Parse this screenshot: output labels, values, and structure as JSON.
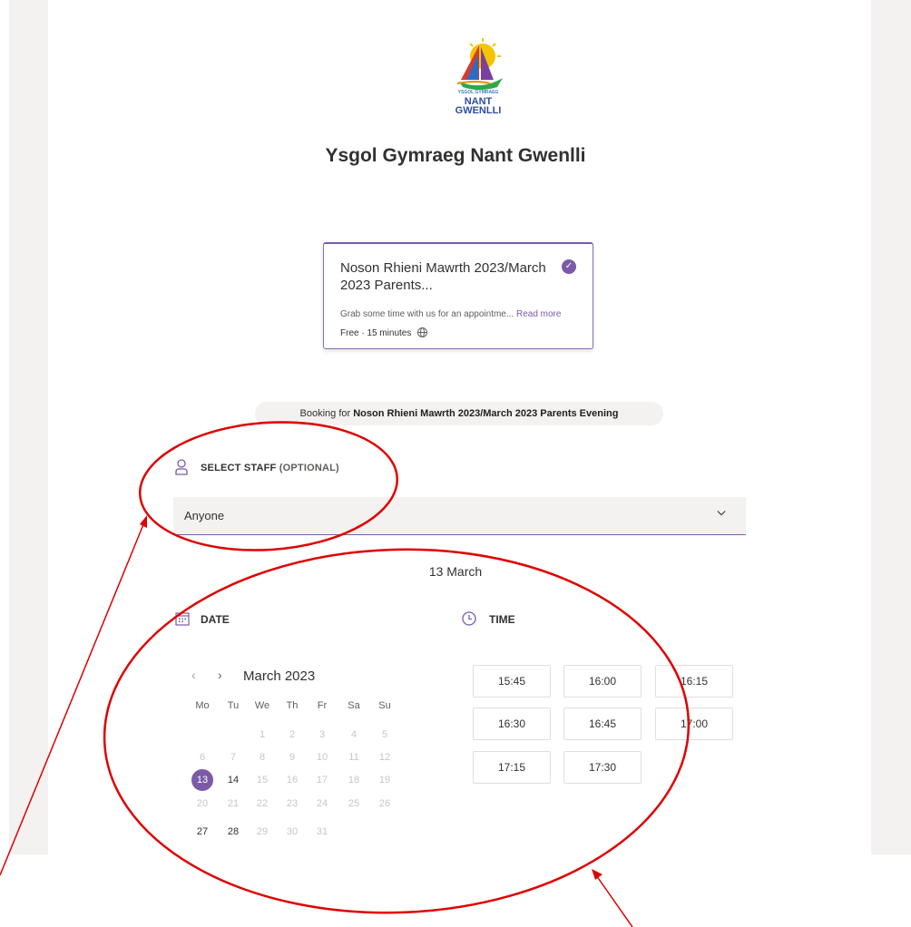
{
  "business": {
    "logo_text_small": "YSGOL GYMRAEG",
    "logo_text_main_1": "NANT",
    "logo_text_main_2": "GWENLLI",
    "name": "Ysgol Gymraeg Nant Gwenlli"
  },
  "service_card": {
    "title": "Noson Rhieni Mawrth 2023/March 2023 Parents...",
    "description": "Grab some time with us for an appointme...",
    "read_more": "Read more",
    "meta": "Free · 15 minutes",
    "selected": true
  },
  "booking": {
    "prefix": "Booking for ",
    "service_full": "Noson Rhieni Mawrth 2023/March 2023 Parents Evening"
  },
  "staff": {
    "heading": "SELECT STAFF",
    "optional": "(OPTIONAL)",
    "selected": "Anyone"
  },
  "selected_date_label": "13 March",
  "date_section": {
    "heading": "DATE",
    "prev_icon": "‹",
    "next_icon": "›",
    "month": "March 2023",
    "weekdays": [
      "Mo",
      "Tu",
      "We",
      "Th",
      "Fr",
      "Sa",
      "Su"
    ],
    "rows": [
      [
        "",
        "",
        "1",
        "2",
        "3",
        "4",
        "5"
      ],
      [
        "6",
        "7",
        "8",
        "9",
        "10",
        "11",
        "12"
      ],
      [
        "13",
        "14",
        "15",
        "16",
        "17",
        "18",
        "19"
      ],
      [
        "20",
        "21",
        "22",
        "23",
        "24",
        "25",
        "26"
      ],
      [
        "27",
        "28",
        "29",
        "30",
        "31",
        "",
        ""
      ]
    ],
    "available": [
      "13",
      "14",
      "27",
      "28"
    ],
    "selected_day": "13"
  },
  "time_section": {
    "heading": "TIME",
    "slots": [
      "15:45",
      "16:00",
      "16:15",
      "16:30",
      "16:45",
      "17:00",
      "17:15",
      "17:30"
    ]
  },
  "colors": {
    "accent": "#7b5ba8",
    "annotation": "#e00000",
    "panel": "#f3f2f1"
  }
}
